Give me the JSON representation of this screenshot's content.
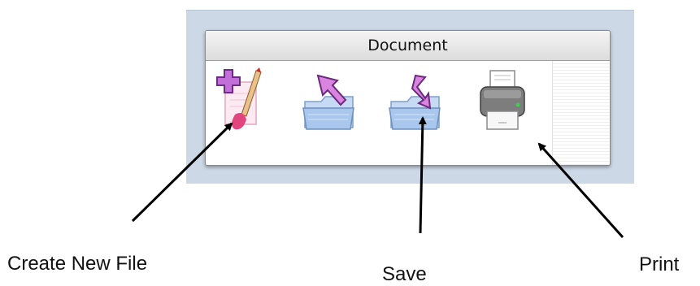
{
  "toolbar": {
    "title": "Document",
    "buttons": [
      {
        "id": "create-new-file",
        "icon": "new-file-icon"
      },
      {
        "id": "open",
        "icon": "open-folder-icon"
      },
      {
        "id": "save",
        "icon": "save-folder-icon"
      },
      {
        "id": "print",
        "icon": "printer-icon"
      }
    ]
  },
  "callouts": {
    "create": "Create New File",
    "save": "Save",
    "print": "Print"
  },
  "colors": {
    "panel": "#ccd8e6",
    "plus": "#b057c4",
    "folder": "#a9c6ec",
    "arrow_pink": "#d985df"
  }
}
